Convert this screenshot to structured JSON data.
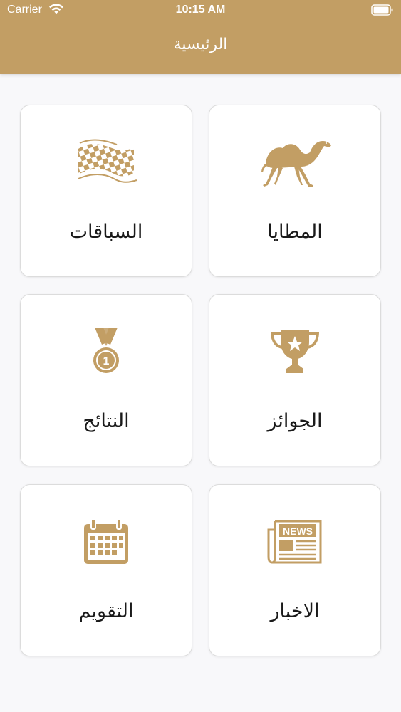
{
  "status_bar": {
    "carrier": "Carrier",
    "time": "10:15 AM"
  },
  "header": {
    "title": "الرئيسية"
  },
  "colors": {
    "header": "#c29e64",
    "icon": "#c29e64",
    "background": "#f8f8fa"
  },
  "tiles": [
    {
      "label": "المطايا",
      "icon": "camel-icon"
    },
    {
      "label": "السباقات",
      "icon": "checkered-flag-icon"
    },
    {
      "label": "الجوائز",
      "icon": "trophy-icon"
    },
    {
      "label": "النتائج",
      "icon": "medal-icon",
      "icon_text": "1"
    },
    {
      "label": "الاخبار",
      "icon": "newspaper-icon",
      "icon_text": "NEWS"
    },
    {
      "label": "التقويم",
      "icon": "calendar-icon"
    }
  ]
}
